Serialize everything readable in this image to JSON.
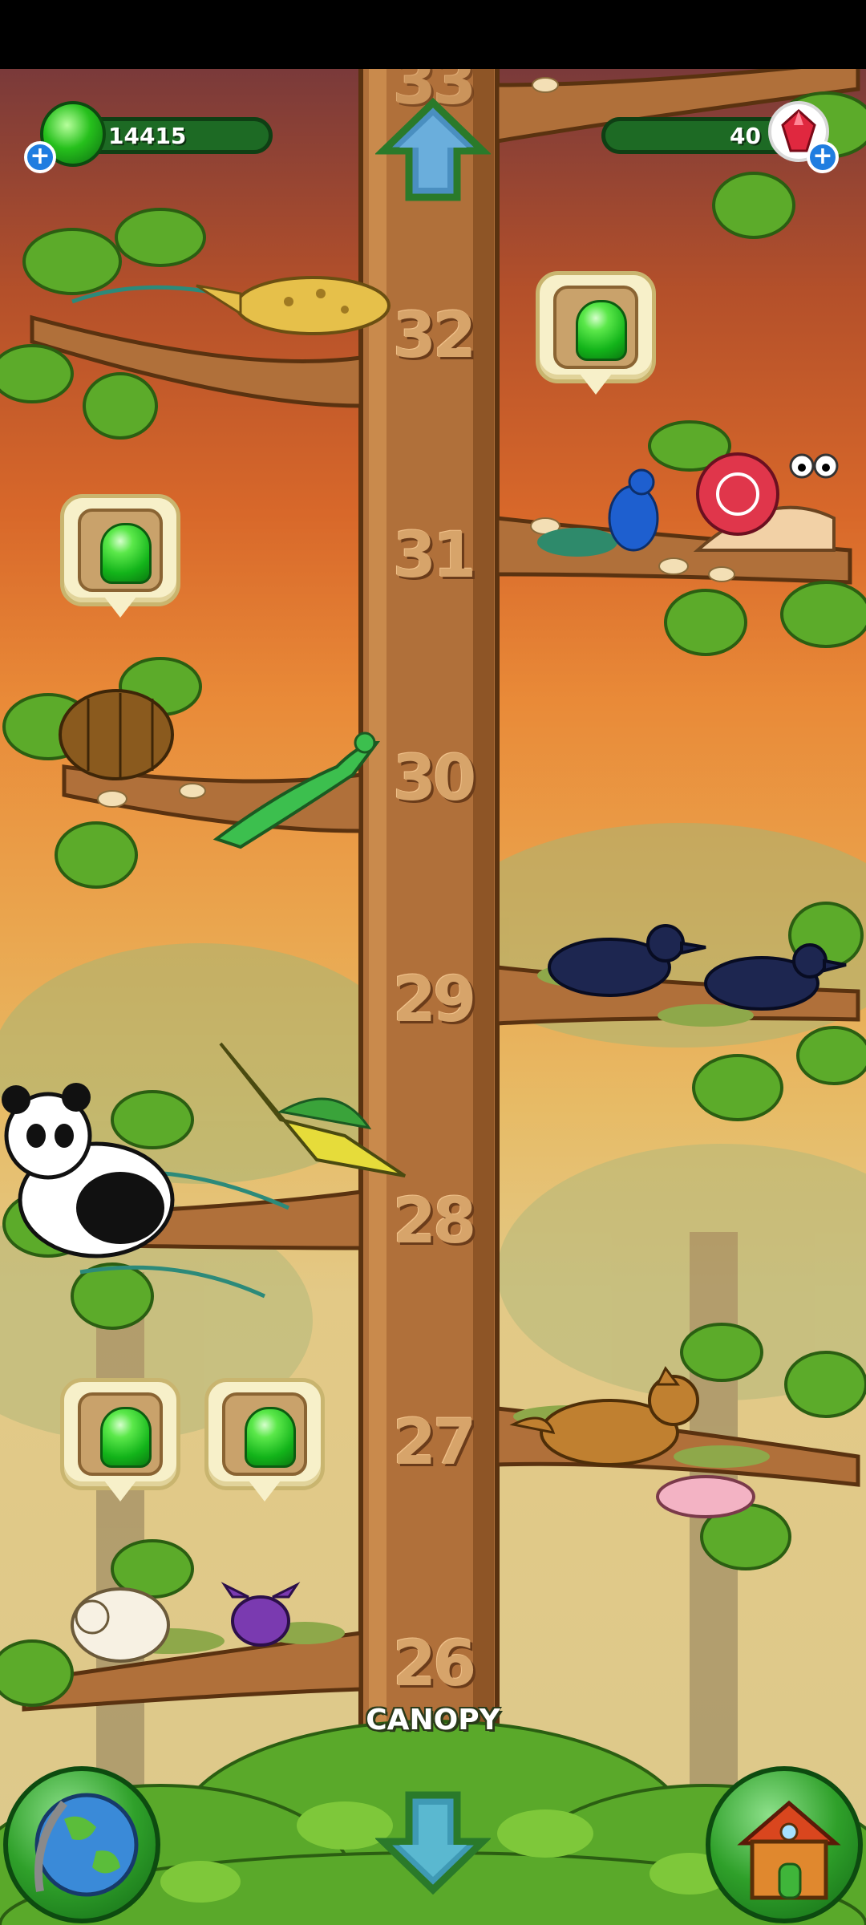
{
  "hud": {
    "jelly_count": "14415",
    "gem_count": "40",
    "plus_symbol": "+"
  },
  "levels": [
    "32",
    "31",
    "30",
    "29",
    "28",
    "27",
    "26"
  ],
  "top_partial_level": "33",
  "area_label": "CANOPY",
  "icons": {
    "jelly_currency": "green-jelly-icon",
    "gem_currency": "red-gem-icon",
    "up": "up-arrow-icon",
    "down": "down-arrow-icon",
    "globe": "globe-icon",
    "house": "house-icon"
  },
  "animals": [
    "flying-fish",
    "peacock",
    "snail",
    "armadillo",
    "basilisk-lizard",
    "crow",
    "crow",
    "panda",
    "pterodactyl",
    "coyote",
    "naked-mole-rat",
    "sheep",
    "purple-bat"
  ],
  "colors": {
    "trunk": "#b0703a",
    "leaf": "#5cab2a",
    "jelly": "#13b41a",
    "bubble": "#f7f0c9"
  }
}
